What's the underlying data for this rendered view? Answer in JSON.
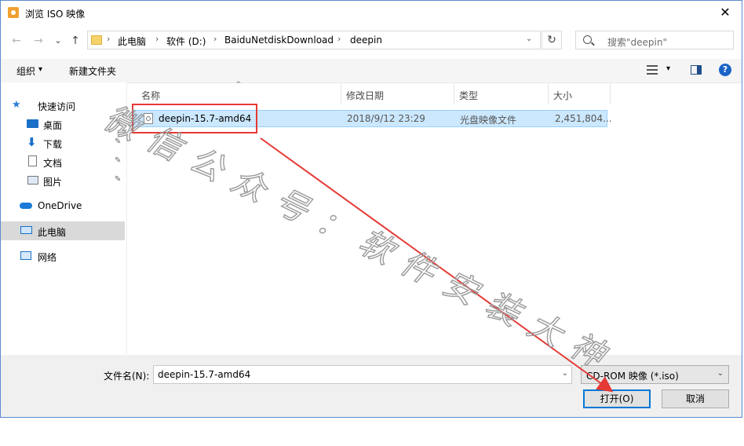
{
  "window": {
    "title": "浏览 ISO 映像",
    "close_glyph": "✕"
  },
  "nav": {
    "back_glyph": "←",
    "forward_glyph": "→",
    "history_glyph": "⌄",
    "up_glyph": "↑",
    "breadcrumb": [
      "此电脑",
      "软件 (D:)",
      "BaiduNetdiskDownload",
      "deepin"
    ],
    "sep": "›",
    "refresh_glyph": "↻",
    "search_placeholder": "搜索\"deepin\""
  },
  "toolbar": {
    "organize": "组织",
    "organize_dd": "▾",
    "new_folder": "新建文件夹",
    "view_dd": "▾",
    "help": "?"
  },
  "sidebar": {
    "items": [
      {
        "label": "快速访问",
        "icon": "star-icon",
        "pinned": false
      },
      {
        "label": "桌面",
        "icon": "desktop-icon",
        "pinned": true
      },
      {
        "label": "下载",
        "icon": "download-icon",
        "pinned": true
      },
      {
        "label": "文档",
        "icon": "document-icon",
        "pinned": true
      },
      {
        "label": "图片",
        "icon": "pictures-icon",
        "pinned": true
      },
      {
        "label": "OneDrive",
        "icon": "cloud-icon",
        "pinned": false
      },
      {
        "label": "此电脑",
        "icon": "computer-icon",
        "pinned": false,
        "selected": true
      },
      {
        "label": "网络",
        "icon": "network-icon",
        "pinned": false
      }
    ],
    "pin_glyph": "📌"
  },
  "table": {
    "columns": [
      "名称",
      "修改日期",
      "类型",
      "大小"
    ],
    "sort_glyph": "^",
    "rows": [
      {
        "name": "deepin-15.7-amd64",
        "modified": "2018/9/12 23:29",
        "type": "光盘映像文件",
        "size": "2,451,804..."
      }
    ]
  },
  "bottom": {
    "filename_label": "文件名(N):",
    "filename_value": "deepin-15.7-amd64",
    "filetype_value": "CD-ROM 映像 (*.iso)",
    "dd_glyph": "⌄",
    "open_label": "打开(O)",
    "cancel_label": "取消"
  },
  "annotation": {
    "watermark": "微信公众号：软件安装大神",
    "color": "#e53935"
  }
}
